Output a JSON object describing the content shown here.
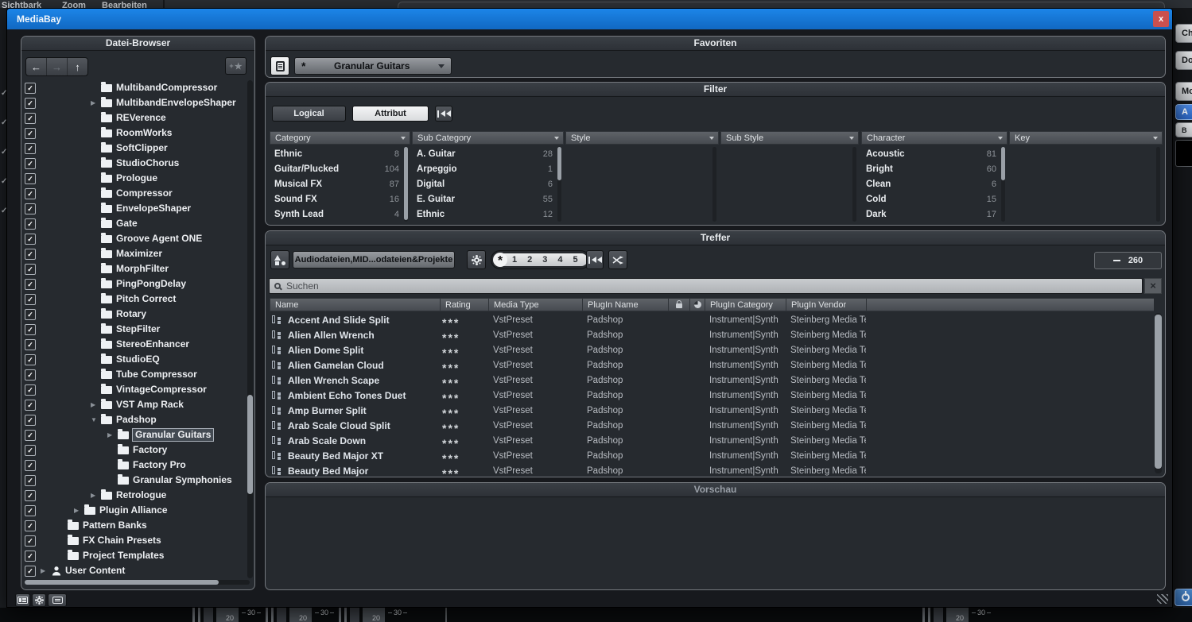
{
  "colors": {
    "titlebar": "#1b80e0",
    "close_button": "#c9504e",
    "accent_blue": "#2e72d4",
    "panel_bg": "#262a2f"
  },
  "icons": {
    "check": "✓",
    "collapsed_arrow": "▶",
    "expanded_arrow": "▼",
    "back_arrow": "←",
    "forward_arrow": "→",
    "up_arrow": "↑",
    "add_plus": "+",
    "favorite_star": "★",
    "close": "x",
    "search_clear": "×"
  },
  "background": {
    "menu_items": [
      "Sichtbark",
      "Zoom",
      "Bearbeiten"
    ],
    "side_buttons": [
      {
        "label": "Ch"
      },
      {
        "label": "Do"
      },
      {
        "label": "Mo"
      },
      {
        "label": "A",
        "active": true
      },
      {
        "label": "B"
      }
    ],
    "meter_low": "20",
    "meter_high": "30"
  },
  "window": {
    "title": "MediaBay"
  },
  "file_browser": {
    "title": "Datei-Browser",
    "items": [
      {
        "label": "MultibandCompressor",
        "indent": 3,
        "expand": "",
        "icon": "folder"
      },
      {
        "label": "MultibandEnvelopeShaper",
        "indent": 3,
        "expand": "closed",
        "icon": "folder"
      },
      {
        "label": "REVerence",
        "indent": 3,
        "expand": "",
        "icon": "folder"
      },
      {
        "label": "RoomWorks",
        "indent": 3,
        "expand": "",
        "icon": "folder"
      },
      {
        "label": "SoftClipper",
        "indent": 3,
        "expand": "",
        "icon": "folder"
      },
      {
        "label": "StudioChorus",
        "indent": 3,
        "expand": "",
        "icon": "folder"
      },
      {
        "label": "Prologue",
        "indent": 3,
        "expand": "",
        "icon": "folder"
      },
      {
        "label": "Compressor",
        "indent": 3,
        "expand": "",
        "icon": "folder"
      },
      {
        "label": "EnvelopeShaper",
        "indent": 3,
        "expand": "",
        "icon": "folder"
      },
      {
        "label": "Gate",
        "indent": 3,
        "expand": "",
        "icon": "folder"
      },
      {
        "label": "Groove Agent ONE",
        "indent": 3,
        "expand": "",
        "icon": "folder"
      },
      {
        "label": "Maximizer",
        "indent": 3,
        "expand": "",
        "icon": "folder"
      },
      {
        "label": "MorphFilter",
        "indent": 3,
        "expand": "",
        "icon": "folder"
      },
      {
        "label": "PingPongDelay",
        "indent": 3,
        "expand": "",
        "icon": "folder"
      },
      {
        "label": "Pitch Correct",
        "indent": 3,
        "expand": "",
        "icon": "folder"
      },
      {
        "label": "Rotary",
        "indent": 3,
        "expand": "",
        "icon": "folder"
      },
      {
        "label": "StepFilter",
        "indent": 3,
        "expand": "",
        "icon": "folder"
      },
      {
        "label": "StereoEnhancer",
        "indent": 3,
        "expand": "",
        "icon": "folder"
      },
      {
        "label": "StudioEQ",
        "indent": 3,
        "expand": "",
        "icon": "folder"
      },
      {
        "label": "Tube Compressor",
        "indent": 3,
        "expand": "",
        "icon": "folder"
      },
      {
        "label": "VintageCompressor",
        "indent": 3,
        "expand": "",
        "icon": "folder"
      },
      {
        "label": "VST Amp Rack",
        "indent": 3,
        "expand": "closed",
        "icon": "folder"
      },
      {
        "label": "Padshop",
        "indent": 3,
        "expand": "open",
        "icon": "folder"
      },
      {
        "label": "Granular Guitars",
        "indent": 4,
        "expand": "closed",
        "icon": "folder",
        "selected": true
      },
      {
        "label": "Factory",
        "indent": 4,
        "expand": "",
        "icon": "folder"
      },
      {
        "label": "Factory Pro",
        "indent": 4,
        "expand": "",
        "icon": "folder"
      },
      {
        "label": "Granular Symphonies",
        "indent": 4,
        "expand": "",
        "icon": "folder"
      },
      {
        "label": "Retrologue",
        "indent": 3,
        "expand": "closed",
        "icon": "folder"
      },
      {
        "label": "Plugin Alliance",
        "indent": 2,
        "expand": "closed",
        "icon": "folder"
      },
      {
        "label": "Pattern Banks",
        "indent": 1,
        "expand": "",
        "icon": "folder"
      },
      {
        "label": "FX Chain Presets",
        "indent": 1,
        "expand": "",
        "icon": "folder"
      },
      {
        "label": "Project Templates",
        "indent": 1,
        "expand": "",
        "icon": "folder"
      },
      {
        "label": "User Content",
        "indent": 0,
        "expand": "closed",
        "icon": "user"
      }
    ]
  },
  "favorites": {
    "title": "Favoriten",
    "star": "*",
    "selected_preset": "Granular Guitars"
  },
  "filter": {
    "title": "Filter",
    "logical_label": "Logical",
    "attribute_label": "Attribut",
    "columns": [
      {
        "name": "Category",
        "thumb": "full",
        "items": [
          {
            "label": "Ethnic",
            "count": "8"
          },
          {
            "label": "Guitar/Plucked",
            "count": "104"
          },
          {
            "label": "Musical FX",
            "count": "87"
          },
          {
            "label": "Sound FX",
            "count": "16"
          },
          {
            "label": "Synth Lead",
            "count": "4"
          }
        ]
      },
      {
        "name": "Sub Category",
        "thumb": "top",
        "items": [
          {
            "label": "A. Guitar",
            "count": "28"
          },
          {
            "label": "Arpeggio",
            "count": "1"
          },
          {
            "label": "Digital",
            "count": "6"
          },
          {
            "label": "E. Guitar",
            "count": "55"
          },
          {
            "label": "Ethnic",
            "count": "12"
          }
        ]
      },
      {
        "name": "Style",
        "thumb": "",
        "items": []
      },
      {
        "name": "Sub Style",
        "thumb": "",
        "items": []
      },
      {
        "name": "Character",
        "thumb": "top",
        "items": [
          {
            "label": "Acoustic",
            "count": "81"
          },
          {
            "label": "Bright",
            "count": "60"
          },
          {
            "label": "Clean",
            "count": "6"
          },
          {
            "label": "Cold",
            "count": "15"
          },
          {
            "label": "Dark",
            "count": "17"
          }
        ]
      },
      {
        "name": "Key",
        "thumb": "",
        "items": []
      }
    ]
  },
  "results": {
    "title": "Treffer",
    "media_types_value": "Audiodateien,MID...odateien&Projekte",
    "rating_star": "*",
    "rating_levels": [
      "1",
      "2",
      "3",
      "4",
      "5"
    ],
    "result_count": "260",
    "search_placeholder": "Suchen",
    "table": {
      "headers": {
        "name": "Name",
        "rating": "Rating",
        "media_type": "Media Type",
        "plugin_name": "PlugIn Name",
        "plugin_category": "PlugIn Category",
        "plugin_vendor": "PlugIn Vendor"
      },
      "rows": [
        {
          "name": "Accent And Slide Split",
          "rating": "***",
          "media_type": "VstPreset",
          "plugin_name": "Padshop",
          "plugin_category": "Instrument|Synth",
          "plugin_vendor": "Steinberg Media Tec"
        },
        {
          "name": "Alien Allen Wrench",
          "rating": "***",
          "media_type": "VstPreset",
          "plugin_name": "Padshop",
          "plugin_category": "Instrument|Synth",
          "plugin_vendor": "Steinberg Media Tec"
        },
        {
          "name": "Alien Dome Split",
          "rating": "***",
          "media_type": "VstPreset",
          "plugin_name": "Padshop",
          "plugin_category": "Instrument|Synth",
          "plugin_vendor": "Steinberg Media Tec"
        },
        {
          "name": "Alien Gamelan Cloud",
          "rating": "***",
          "media_type": "VstPreset",
          "plugin_name": "Padshop",
          "plugin_category": "Instrument|Synth",
          "plugin_vendor": "Steinberg Media Tec"
        },
        {
          "name": "Allen Wrench Scape",
          "rating": "***",
          "media_type": "VstPreset",
          "plugin_name": "Padshop",
          "plugin_category": "Instrument|Synth",
          "plugin_vendor": "Steinberg Media Tec"
        },
        {
          "name": "Ambient Echo Tones Duet",
          "rating": "***",
          "media_type": "VstPreset",
          "plugin_name": "Padshop",
          "plugin_category": "Instrument|Synth",
          "plugin_vendor": "Steinberg Media Tec"
        },
        {
          "name": "Amp Burner Split",
          "rating": "***",
          "media_type": "VstPreset",
          "plugin_name": "Padshop",
          "plugin_category": "Instrument|Synth",
          "plugin_vendor": "Steinberg Media Tec"
        },
        {
          "name": "Arab Scale Cloud Split",
          "rating": "***",
          "media_type": "VstPreset",
          "plugin_name": "Padshop",
          "plugin_category": "Instrument|Synth",
          "plugin_vendor": "Steinberg Media Tec"
        },
        {
          "name": "Arab Scale Down",
          "rating": "***",
          "media_type": "VstPreset",
          "plugin_name": "Padshop",
          "plugin_category": "Instrument|Synth",
          "plugin_vendor": "Steinberg Media Tec"
        },
        {
          "name": "Beauty Bed Major XT",
          "rating": "***",
          "media_type": "VstPreset",
          "plugin_name": "Padshop",
          "plugin_category": "Instrument|Synth",
          "plugin_vendor": "Steinberg Media Tec"
        },
        {
          "name": "Beauty Bed Major",
          "rating": "***",
          "media_type": "VstPreset",
          "plugin_name": "Padshop",
          "plugin_category": "Instrument|Synth",
          "plugin_vendor": "Steinberg Media Tec"
        }
      ]
    }
  },
  "preview": {
    "title": "Vorschau"
  }
}
